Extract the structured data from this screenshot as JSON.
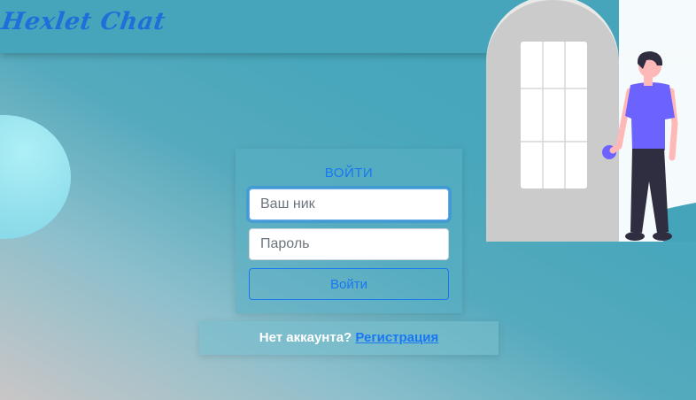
{
  "app": {
    "logo": "Hexlet Chat"
  },
  "login": {
    "title": "ВОЙТИ",
    "username_placeholder": "Ваш ник",
    "password_placeholder": "Пароль",
    "submit_label": "Войти"
  },
  "signup": {
    "prompt": "Нет аккаунта?",
    "link_label": "Регистрация"
  },
  "colors": {
    "accent": "#1877f2",
    "header_bg": "#46a5bb",
    "person_shirt": "#6c63ff",
    "person_pants": "#2f2e41",
    "door": "#cccccc"
  }
}
